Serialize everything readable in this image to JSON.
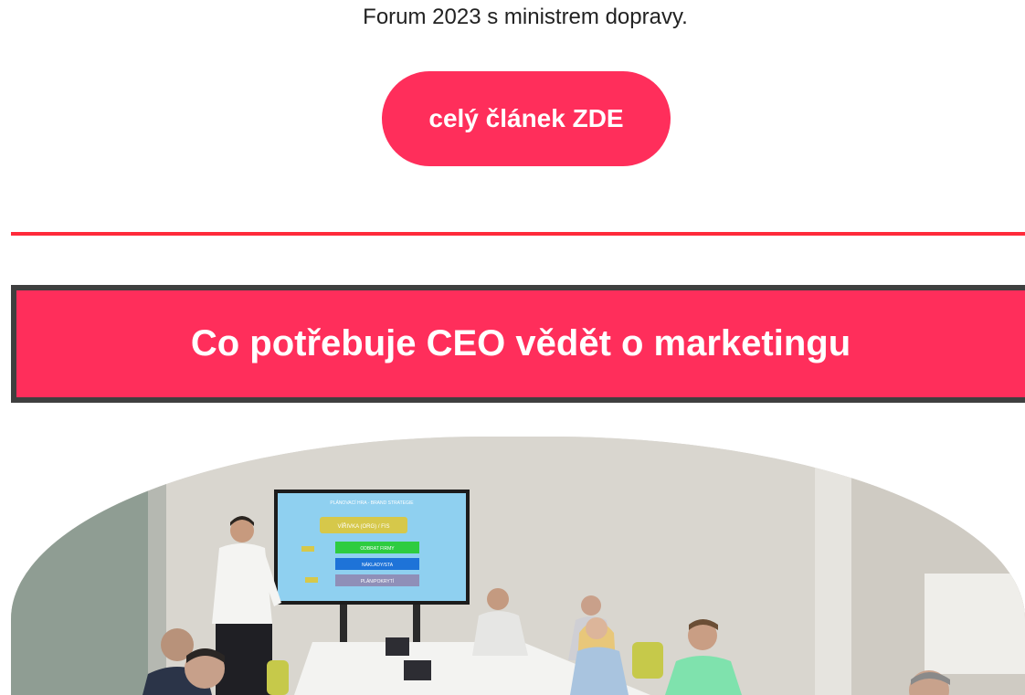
{
  "intro": {
    "text": "Forum 2023 s ministrem dopravy."
  },
  "cta": {
    "label": "celý článek ZDE"
  },
  "section": {
    "title": "Co potřebuje CEO vědět o marketingu"
  },
  "photo": {
    "screen_title": "PLÁNOVACÍ HRA - BRAND STRATEGIE",
    "screen_banner": "VÍŘIVKA (ORG) / FIS",
    "screen_buttons": [
      "ODBRAT FIRMY",
      "NÁKLADY/STA",
      "PLÁN/POKRYTÍ"
    ]
  },
  "colors": {
    "accent": "#ff2e5b",
    "divider": "#ff2a3a",
    "header_border": "#3f3f3f"
  }
}
